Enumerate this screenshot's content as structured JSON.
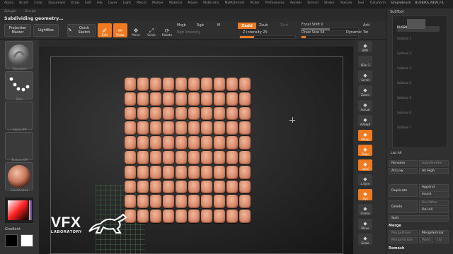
{
  "menu": {
    "items": [
      "Alpha",
      "Brush",
      "Color",
      "Document",
      "Draw",
      "Edit",
      "File",
      "Layer",
      "Light",
      "Macro",
      "Marker",
      "Material",
      "Movie",
      "MyBrushs",
      "MyMaterials",
      "Picker",
      "Preferences",
      "Render",
      "Stencil",
      "Stroke",
      "Texture",
      "Tool",
      "Transform"
    ],
    "second_row": [
      "Zplugin",
      "Zscript"
    ],
    "right_items": [
      "SimpleBrush",
      "BUSBIKA_NEW_FIL"
    ]
  },
  "status_text": "Subdividing geometry...",
  "toolbar": {
    "projection_master": "Projection Master",
    "lightbox": "LightBox",
    "quick_sketch": "Quick Sketch",
    "tools": [
      {
        "label": "Edit",
        "icon": "edit-icon",
        "active": true
      },
      {
        "label": "Draw",
        "icon": "draw-icon",
        "active": true
      },
      {
        "label": "Move",
        "icon": "move-icon",
        "active": false
      },
      {
        "label": "Scale",
        "icon": "scale-icon",
        "active": false
      },
      {
        "label": "Rotate",
        "icon": "rotate-icon",
        "active": false
      }
    ],
    "mrgb": "Mrgb",
    "rgb": "Rgb",
    "m": "M",
    "rgb_intensity": "Rgb Intensity",
    "zadd": "Zadd",
    "zsub": "Zsub",
    "zcut": "Zcut",
    "z_intensity": "Z Intensity 25",
    "z_intensity_value": 25,
    "focal_shift": "Focal Shift 0",
    "draw_size": "Draw Size 64",
    "dynamic": "Dynamic",
    "act": "Acti",
    "total": "Tot"
  },
  "left_tray": {
    "tiles": [
      {
        "label": "Standard"
      },
      {
        "label": "Dots"
      },
      {
        "label": "Alpha Off"
      },
      {
        "label": "Texture Off"
      },
      {
        "label": "SkinShade4"
      }
    ],
    "gradient_label": "Gradient"
  },
  "logo": {
    "title": "VFX",
    "subtitle": "LABORATORY"
  },
  "right_shelf": {
    "buttons": [
      {
        "label": "BPR",
        "icon": "bpr-icon",
        "active": false
      },
      {
        "label": "SPix 3",
        "icon": "",
        "active": false
      },
      {
        "label": "Scroll",
        "icon": "scroll-icon",
        "active": false
      },
      {
        "label": "Zoom",
        "icon": "zoom-icon",
        "active": false
      },
      {
        "label": "Actual",
        "icon": "actual-icon",
        "active": false
      },
      {
        "label": "AAHalf",
        "icon": "aahalf-icon",
        "active": false
      },
      {
        "label": "Persp",
        "icon": "persp-icon",
        "active": true
      },
      {
        "label": "Floor",
        "icon": "floor-icon",
        "active": true
      },
      {
        "label": "Local",
        "icon": "local-icon",
        "active": true
      },
      {
        "label": "L.Sym",
        "icon": "lsym-icon",
        "active": false
      },
      {
        "label": "Xyz",
        "icon": "xyz-icon",
        "active": true
      },
      {
        "label": "Frame",
        "icon": "frame-icon",
        "active": false
      },
      {
        "label": "Move",
        "icon": "move-view-icon",
        "active": false
      },
      {
        "label": "Scale",
        "icon": "scale-view-icon",
        "active": false
      }
    ]
  },
  "right_panel": {
    "tabs": [
      "SimpleBrush",
      "BUSBIKA_NEW_FIL"
    ],
    "title": "SubTool",
    "subtools": [
      {
        "label": "BUSBIKA_NEW_FIL",
        "active": true
      },
      {
        "label": "Subtool 1",
        "active": false
      },
      {
        "label": "Subtool 2",
        "active": false
      },
      {
        "label": "Subtool 3",
        "active": false
      },
      {
        "label": "Subtool 4",
        "active": false
      },
      {
        "label": "Subtool 5",
        "active": false
      },
      {
        "label": "Subtool 6",
        "active": false
      },
      {
        "label": "Subtool 7",
        "active": false
      }
    ],
    "list_all": "List All",
    "rename": "Rename",
    "autoreorder": "AutoReorder",
    "all_low": "All Low",
    "all_high": "All High",
    "duplicate": "Duplicate",
    "append": "Append",
    "insert": "Insert",
    "delete": "Delete",
    "del_other": "Del Other",
    "del_all": "Del All",
    "split": "Split",
    "merge": "Merge",
    "merge_down": "MergeDown",
    "merge_similar": "MergeSimilar",
    "merge_visible": "MergeVisible",
    "weld": "Weld",
    "uv": "Uv",
    "remesh": "Remesh"
  }
}
